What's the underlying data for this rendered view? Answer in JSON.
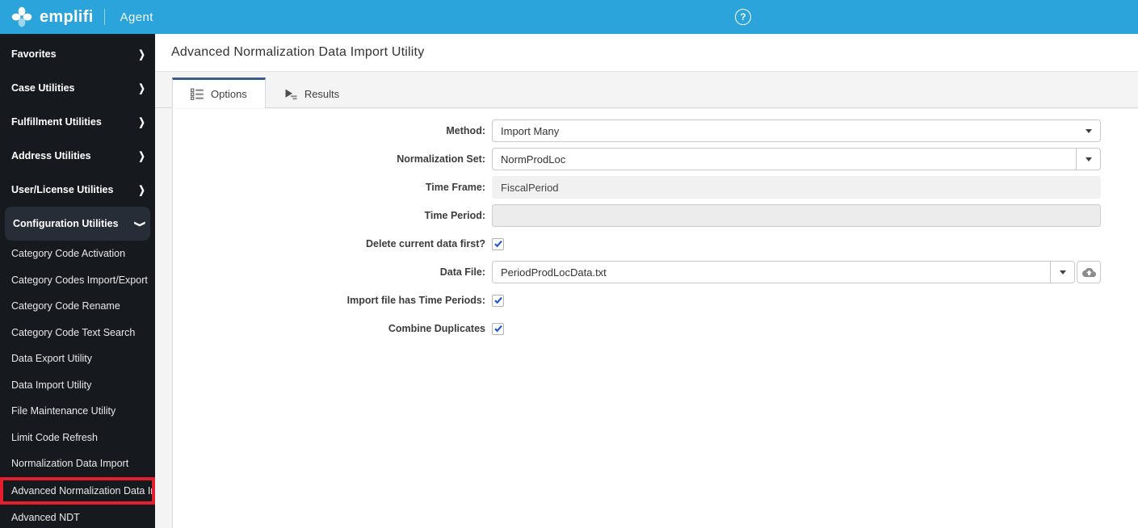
{
  "topbar": {
    "brand": "emplifi",
    "product": "Agent",
    "help_label": "?"
  },
  "sidebar": {
    "top_items": [
      {
        "label": "Favorites",
        "expanded": false
      },
      {
        "label": "Case Utilities",
        "expanded": false
      },
      {
        "label": "Fulfillment Utilities",
        "expanded": false
      },
      {
        "label": "Address Utilities",
        "expanded": false
      },
      {
        "label": "User/License Utilities",
        "expanded": false
      },
      {
        "label": "Configuration Utilities",
        "expanded": true
      }
    ],
    "sub_items": [
      "Category Code Activation",
      "Category Codes Import/Export",
      "Category Code Rename",
      "Category Code Text Search",
      "Data Export Utility",
      "Data Import Utility",
      "File Maintenance Utility",
      "Limit Code Refresh",
      "Normalization Data Import",
      "Advanced Normalization Data Import Utility",
      "Advanced NDT"
    ],
    "annotated_item": "Advanced Normalization Data Import Utility",
    "annotation_color": "#e41f2d"
  },
  "page": {
    "title": "Advanced Normalization Data Import Utility"
  },
  "tabs": [
    {
      "label": "Options",
      "icon": "list-icon",
      "active": true
    },
    {
      "label": "Results",
      "icon": "run-results-icon",
      "active": false
    }
  ],
  "form": {
    "method": {
      "label": "Method:",
      "value": "Import Many"
    },
    "normalization_set": {
      "label": "Normalization Set:",
      "value": "NormProdLoc"
    },
    "time_frame": {
      "label": "Time Frame:",
      "value": "FiscalPeriod"
    },
    "time_period": {
      "label": "Time Period:",
      "value": ""
    },
    "delete_first": {
      "label": "Delete current data first?",
      "checked": true
    },
    "data_file": {
      "label": "Data File:",
      "value": "PeriodProdLocData.txt"
    },
    "import_has_time_periods": {
      "label": "Import file has Time Periods:",
      "checked": true
    },
    "combine_duplicates": {
      "label": "Combine Duplicates",
      "checked": true
    }
  },
  "colors": {
    "topbar_bg": "#2aa4da",
    "sidebar_bg": "#16191e",
    "sidebar_highlight": "#272d36",
    "active_tab_accent": "#3d5c8c",
    "checkbox_check": "#2458d5",
    "annotation_red": "#e41f2d"
  }
}
